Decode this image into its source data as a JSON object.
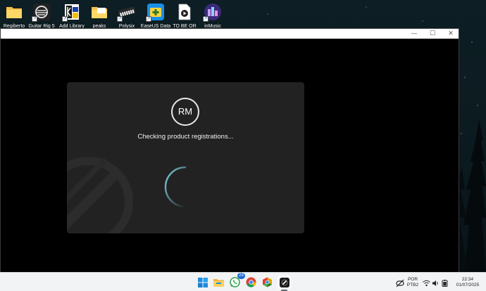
{
  "desktop": {
    "icons": [
      {
        "label": "Regiberto",
        "icon": "folder-icon"
      },
      {
        "label": "Guitar Rig 5",
        "icon": "guitar-rig-icon"
      },
      {
        "label": "Add Library",
        "icon": "add-library-icon"
      },
      {
        "label": "peaks",
        "icon": "folder-icon"
      },
      {
        "label": "Polysix",
        "icon": "polysix-keyboard-icon"
      },
      {
        "label": "EaseUS Data",
        "icon": "easeus-data-icon"
      },
      {
        "label": "TO BE OR",
        "icon": "media-file-icon"
      },
      {
        "label": "inMusic",
        "icon": "inmusic-icon"
      }
    ]
  },
  "window": {
    "controls": {
      "minimize": "—",
      "maximize": "☐",
      "close": "✕"
    }
  },
  "dialog": {
    "avatar_initials": "RM",
    "status": "Checking product registrations...",
    "spinner_color": "#7fd6e6"
  },
  "taskbar": {
    "apps": [
      {
        "name": "start",
        "icon": "windows-start-icon"
      },
      {
        "name": "file-explorer",
        "icon": "folder-icon"
      },
      {
        "name": "whatsapp",
        "icon": "whatsapp-icon",
        "badge": "29"
      },
      {
        "name": "chrome",
        "icon": "chrome-icon"
      },
      {
        "name": "chrome-canary",
        "icon": "chrome-canary-icon"
      },
      {
        "name": "native-access",
        "icon": "native-access-icon",
        "active": true
      }
    ],
    "tray": {
      "language_top": "POR",
      "language_bottom": "PTB2",
      "time": "22:34",
      "date": "01/07/2025"
    }
  },
  "colors": {
    "dialog_bg": "#222222",
    "window_bg": "#000000",
    "taskbar_bg": "#f1f3f4",
    "accent_blue": "#1e6ad6"
  }
}
